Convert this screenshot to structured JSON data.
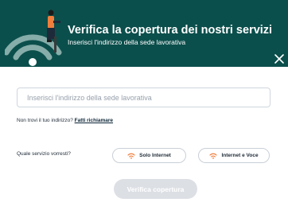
{
  "header": {
    "title": "Verifica la copertura dei nostri servizi",
    "subtitle": "Inserisci l'indirizzo della sede lavorativa"
  },
  "form": {
    "address_placeholder": "Inserisci l'indirizzo della sede lavorativa",
    "hint_text": "Non trovi il tuo indirizzo?",
    "hint_link": "Fatti richiamare",
    "service_question": "Quale servizio vorresti?",
    "options": [
      {
        "label": "Solo Internet",
        "icon": "wifi-icon"
      },
      {
        "label": "Internet e Voce",
        "icon": "wifi-icon"
      }
    ],
    "submit_label": "Verifica copertura"
  },
  "colors": {
    "header_bg": "#0b4f4c",
    "accent_orange": "#f07e3c",
    "button_disabled": "#dcdfe4"
  }
}
